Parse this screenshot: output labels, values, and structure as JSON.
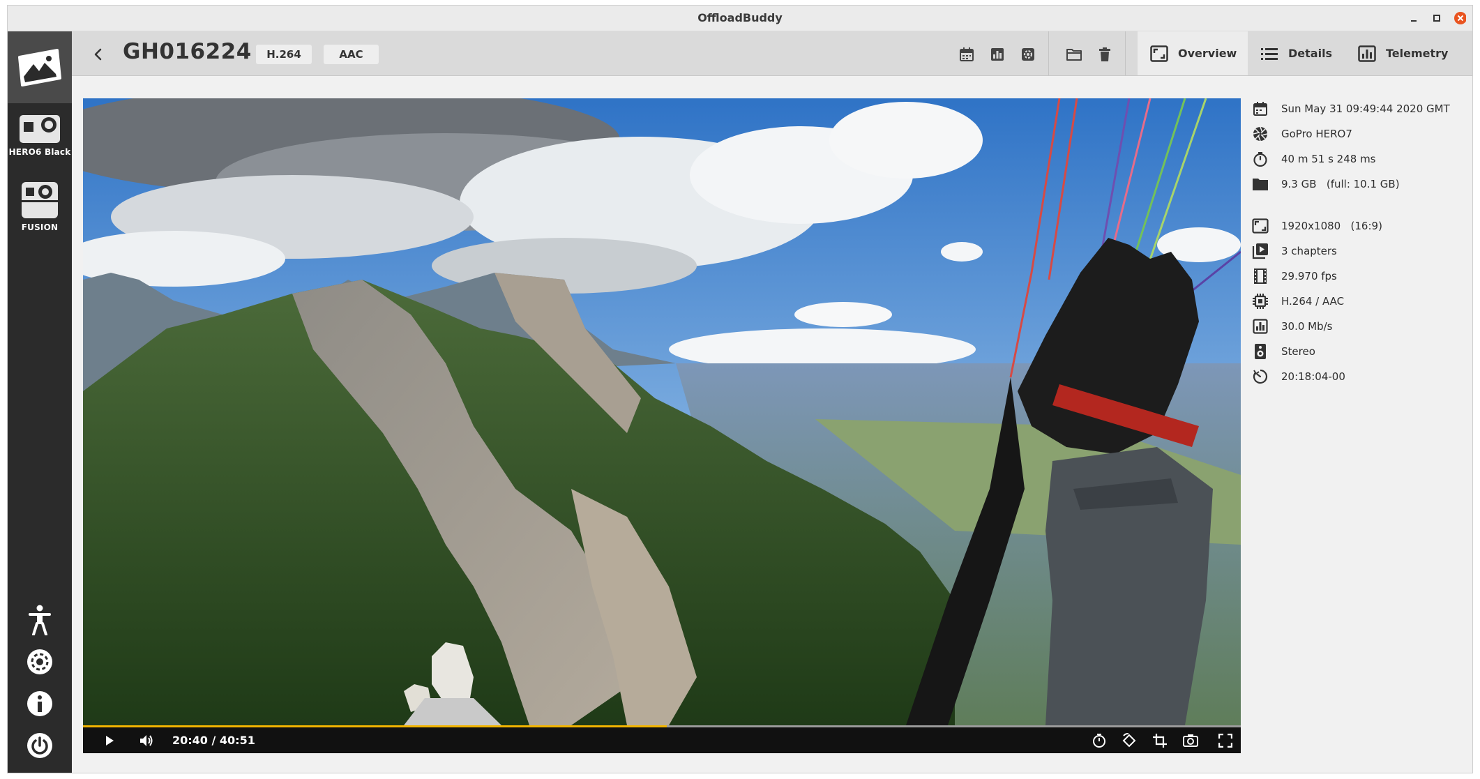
{
  "window": {
    "title": "OffloadBuddy",
    "minimize_icon": "minimize-icon",
    "maximize_icon": "maximize-icon",
    "close_icon": "close-icon",
    "close_color": "#e95420"
  },
  "sidebar": {
    "logo_icon": "app-logo-icon",
    "devices": [
      {
        "label": "HERO6 Black",
        "icon": "camera-icon"
      },
      {
        "label": "FUSION",
        "icon": "camera-icon"
      }
    ],
    "bottom_icons": [
      "accessibility-icon",
      "settings-icon",
      "info-icon",
      "power-icon"
    ]
  },
  "header": {
    "back_icon": "chevron-left-icon",
    "file_name": "GH016224",
    "video_codec": "H.264",
    "audio_codec": "AAC",
    "tools": [
      "calendar-icon",
      "bar-chart-icon",
      "gear-box-icon",
      "folder-icon",
      "trash-icon"
    ],
    "tabs": [
      {
        "label": "Overview",
        "icon": "aspect-icon",
        "active": true
      },
      {
        "label": "Details",
        "icon": "list-icon",
        "active": false
      },
      {
        "label": "Telemetry",
        "icon": "chart-icon",
        "active": false
      }
    ]
  },
  "player": {
    "time": "20:40 / 40:51",
    "progress": 0.504,
    "accent": "#f2b400",
    "left_controls": [
      "play-icon",
      "volume-icon"
    ],
    "right_controls": [
      "timer-icon",
      "rotate-icon",
      "crop-icon",
      "snapshot-icon",
      "fullscreen-icon"
    ]
  },
  "info": {
    "rows": [
      {
        "icon": "calendar-icon",
        "text": "Sun May 31 09:49:44 2020 GMT"
      },
      {
        "icon": "aperture-icon",
        "text": "GoPro HERO7"
      },
      {
        "icon": "stopwatch-icon",
        "text": "40 m 51 s 248 ms"
      },
      {
        "icon": "folder-icon",
        "text": "9.3 GB   (full: 10.1 GB)"
      },
      {
        "icon": "aspect-icon",
        "text": "1920x1080   (16:9)"
      },
      {
        "icon": "chapters-icon",
        "text": "3 chapters"
      },
      {
        "icon": "film-icon",
        "text": "29.970 fps"
      },
      {
        "icon": "chip-icon",
        "text": "H.264 / AAC"
      },
      {
        "icon": "bitrate-icon",
        "text": "30.0 Mb/s"
      },
      {
        "icon": "speaker-icon",
        "text": "Stereo"
      },
      {
        "icon": "timecode-icon",
        "text": "20:18:04-00"
      }
    ]
  }
}
